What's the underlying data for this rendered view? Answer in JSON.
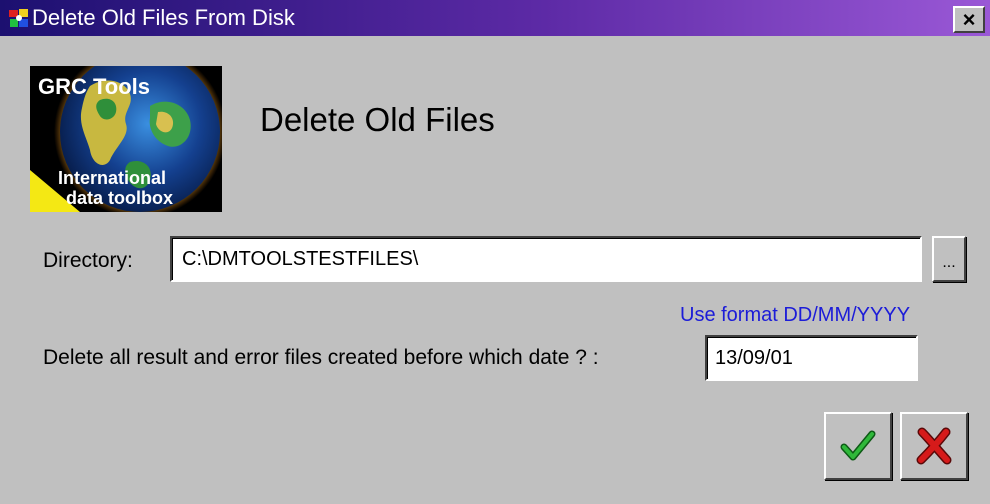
{
  "window": {
    "title": "Delete Old Files From Disk",
    "close_label": "×"
  },
  "logo": {
    "line1": "GRC Tools",
    "line2": "International",
    "line3": "data toolbox"
  },
  "heading": "Delete Old Files",
  "directory": {
    "label": "Directory:",
    "value": "C:\\DMTOOLSTESTFILES\\",
    "browse_label": "..."
  },
  "date": {
    "hint": "Use format DD/MM/YYYY",
    "label": "Delete all result and error files created before which date ? :",
    "value": "13/09/01"
  },
  "buttons": {
    "ok_icon": "checkmark-icon",
    "cancel_icon": "x-icon"
  },
  "colors": {
    "title_bar_start": "#1c1070",
    "title_bar_end": "#9a58d6",
    "hint_text": "#1c1cd8",
    "ok_green": "#1f9a2a",
    "cancel_red": "#c41616"
  }
}
